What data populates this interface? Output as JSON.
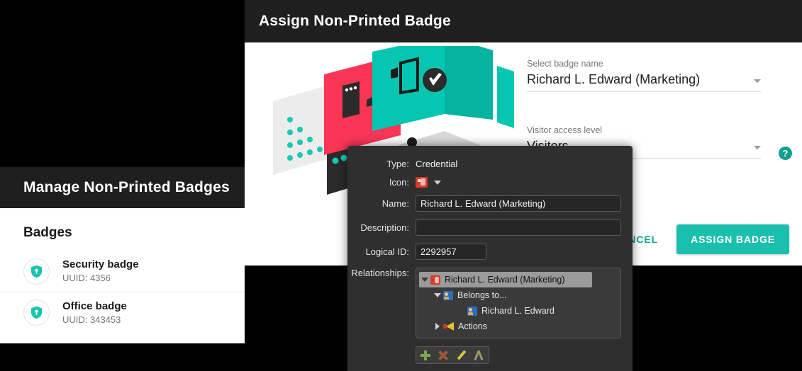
{
  "left_panel": {
    "title": "Manage Non-Printed Badges",
    "section_heading": "Badges",
    "badges": [
      {
        "name": "Security badge",
        "uuid_label": "UUID: 4356",
        "icon": "shield-icon"
      },
      {
        "name": "Office badge",
        "uuid_label": "UUID: 343453",
        "icon": "shield-icon"
      }
    ]
  },
  "modal": {
    "title": "Assign Non-Printed Badge",
    "fields": [
      {
        "label": "Select badge name",
        "value": "Richard L. Edward (Marketing)",
        "has_help": false
      },
      {
        "label": "Visitor access level",
        "value": "Visitors",
        "has_help": true
      }
    ],
    "help_glyph": "?",
    "cancel_label": "CANCEL",
    "assign_label": "ASSIGN BADGE"
  },
  "dialog": {
    "type_label": "Type:",
    "type_value": "Credential",
    "icon_label": "Icon:",
    "icon_name": "credential-badge-icon",
    "name_label": "Name:",
    "name_value": "Richard L. Edward (Marketing)",
    "description_label": "Description:",
    "description_value": "",
    "logical_id_label": "Logical ID:",
    "logical_id_value": "2292957",
    "relationships_label": "Relationships:",
    "tree": [
      {
        "label": "Richard L. Edward (Marketing)",
        "icon": "credential-badge-icon",
        "expander": "down",
        "indent": 0,
        "selected": true
      },
      {
        "label": "Belongs to...",
        "icon": "person-card-icon",
        "expander": "down",
        "indent": 1,
        "selected": false
      },
      {
        "label": "Richard L. Edward",
        "icon": "person-card-icon",
        "expander": "none",
        "indent": 2,
        "selected": false
      },
      {
        "label": "Actions",
        "icon": "megaphone-icon",
        "expander": "right",
        "indent": 1,
        "selected": false
      }
    ],
    "toolbar": [
      {
        "name": "add-relationship-button"
      },
      {
        "name": "delete-relationship-button"
      },
      {
        "name": "edit-relationship-button"
      },
      {
        "name": "unlink-relationship-button"
      }
    ]
  },
  "colors": {
    "accent_teal": "#1bbfae",
    "pink": "#fa3556",
    "teal_panel": "#00c9b1",
    "dark": "#1f1f1f"
  }
}
